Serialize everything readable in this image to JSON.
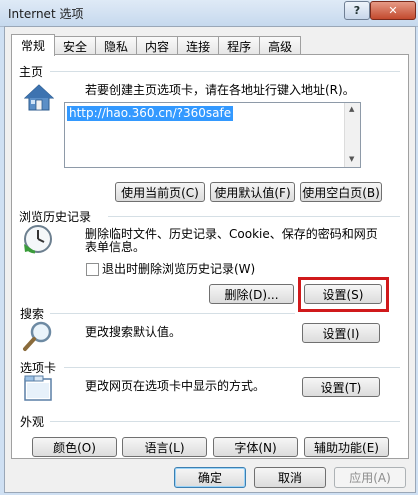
{
  "window": {
    "title": "Internet 选项",
    "help_glyph": "?",
    "close_glyph": "✕"
  },
  "tabs": [
    "常规",
    "安全",
    "隐私",
    "内容",
    "连接",
    "程序",
    "高级"
  ],
  "home": {
    "section": "主页",
    "description": "若要创建主页选项卡，请在各地址行键入地址(R)。",
    "url": "http://hao.360.cn/?360safe",
    "buttons": [
      "使用当前页(C)",
      "使用默认值(F)",
      "使用空白页(B)"
    ]
  },
  "history": {
    "section": "浏览历史记录",
    "description_line1": "删除临时文件、历史记录、Cookie、保存的密码和网页",
    "description_line2": "表单信息。",
    "checkbox_label": "退出时删除浏览历史记录(W)",
    "delete_button": "删除(D)...",
    "settings_button": "设置(S)"
  },
  "search": {
    "section": "搜索",
    "description": "更改搜索默认值。",
    "settings_button": "设置(I)"
  },
  "tabsect": {
    "section": "选项卡",
    "description": "更改网页在选项卡中显示的方式。",
    "settings_button": "设置(T)"
  },
  "appearance": {
    "section": "外观",
    "buttons": [
      "颜色(O)",
      "语言(L)",
      "字体(N)",
      "辅助功能(E)"
    ]
  },
  "footer": {
    "ok": "确定",
    "cancel": "取消",
    "apply": "应用(A)"
  },
  "colors": {
    "highlight": "#d0191b",
    "selection": "#3399ff"
  }
}
